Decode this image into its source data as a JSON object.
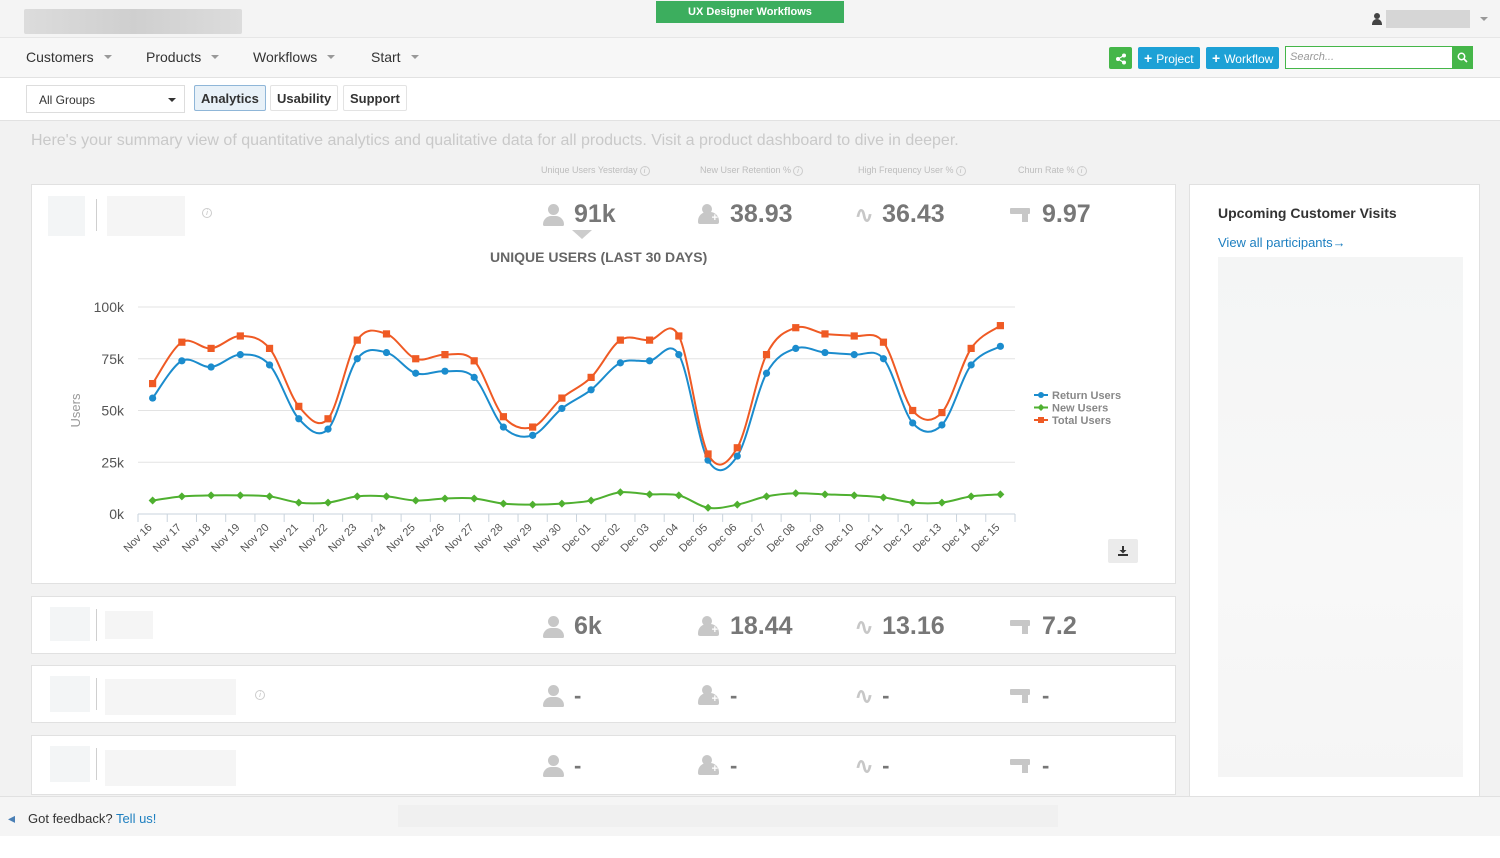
{
  "workspace": "UX Designer Workflows",
  "nav": {
    "items": [
      "Customers",
      "Products",
      "Workflows",
      "Start"
    ],
    "project_label": "Project",
    "workflow_label": "Workflow",
    "search_placeholder": "Search..."
  },
  "subbar": {
    "group_select": "All Groups",
    "tabs": [
      "Analytics",
      "Usability",
      "Support"
    ],
    "active_tab": "Analytics"
  },
  "summary": "Here's your summary view of quantitative analytics and qualitative data for all products. Visit a product dashboard to dive in deeper.",
  "metric_headers": [
    "Unique Users Yesterday",
    "New User Retention %",
    "High Frequency User %",
    "Churn Rate %"
  ],
  "products": [
    {
      "unique_users": "91k",
      "retention": "38.93",
      "high_freq": "36.43",
      "churn": "9.97"
    },
    {
      "unique_users": "6k",
      "retention": "18.44",
      "high_freq": "13.16",
      "churn": "7.2"
    },
    {
      "unique_users": "-",
      "retention": "-",
      "high_freq": "-",
      "churn": "-"
    },
    {
      "unique_users": "-",
      "retention": "-",
      "high_freq": "-",
      "churn": "-"
    }
  ],
  "chart_data": {
    "type": "line",
    "title": "UNIQUE USERS (LAST 30 DAYS)",
    "ylabel": "Users",
    "xlabel": "",
    "ylim": [
      0,
      100000
    ],
    "y_ticks": [
      "0k",
      "25k",
      "50k",
      "75k",
      "100k"
    ],
    "legend_position": "right",
    "categories": [
      "Nov 16",
      "Nov 17",
      "Nov 18",
      "Nov 19",
      "Nov 20",
      "Nov 21",
      "Nov 22",
      "Nov 23",
      "Nov 24",
      "Nov 25",
      "Nov 26",
      "Nov 27",
      "Nov 28",
      "Nov 29",
      "Nov 30",
      "Dec 01",
      "Dec 02",
      "Dec 03",
      "Dec 04",
      "Dec 05",
      "Dec 06",
      "Dec 07",
      "Dec 08",
      "Dec 09",
      "Dec 10",
      "Dec 11",
      "Dec 12",
      "Dec 13",
      "Dec 14",
      "Dec 15"
    ],
    "series": [
      {
        "name": "Return Users",
        "color": "#1b8ccd",
        "marker": "circle",
        "values": [
          56000,
          74000,
          71000,
          77000,
          72000,
          46000,
          41000,
          75000,
          78000,
          68000,
          69000,
          66000,
          42000,
          38000,
          51000,
          60000,
          73000,
          74000,
          77000,
          26000,
          28000,
          68000,
          80000,
          78000,
          77000,
          75000,
          44000,
          43000,
          72000,
          81000
        ]
      },
      {
        "name": "New Users",
        "color": "#4fb030",
        "marker": "diamond",
        "values": [
          6500,
          8500,
          9000,
          9000,
          8500,
          5500,
          5500,
          8500,
          8500,
          6500,
          7500,
          7500,
          5000,
          4500,
          5000,
          6500,
          10500,
          9500,
          9000,
          3000,
          4500,
          8500,
          10000,
          9500,
          9000,
          8000,
          5500,
          5500,
          8500,
          9500
        ]
      },
      {
        "name": "Total Users",
        "color": "#ef5a24",
        "marker": "square",
        "values": [
          63000,
          83000,
          80000,
          86000,
          80000,
          52000,
          46000,
          84000,
          87000,
          75000,
          77000,
          74000,
          47000,
          42000,
          56000,
          66000,
          84000,
          84000,
          86000,
          29000,
          32000,
          77000,
          90000,
          87000,
          86000,
          83000,
          50000,
          49000,
          80000,
          91000
        ]
      }
    ]
  },
  "visits": {
    "title": "Upcoming Customer Visits",
    "link": "View all participants→"
  },
  "footer": {
    "text": "Got feedback?",
    "link": "Tell us!"
  },
  "icons": {
    "share": "share-icon",
    "search": "search-icon",
    "download": "download-icon",
    "users": "user-icon",
    "retention": "add-user-icon",
    "frequency": "wave-icon",
    "churn": "faucet-icon"
  }
}
